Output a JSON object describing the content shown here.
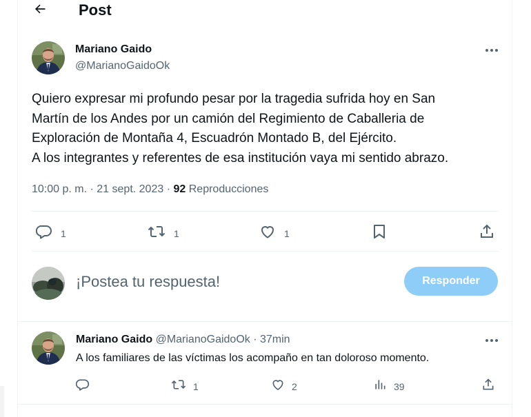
{
  "header": {
    "title": "Post",
    "back_icon": "arrow-left-icon"
  },
  "tweet": {
    "author_name": "Mariano Gaido",
    "author_handle": "@MarianoGaidoOk",
    "text_lines": [
      "Quiero expresar mi profundo pesar por la tragedia sufrida hoy en San",
      "Martín de los Andes por un camión del Regimiento de Caballeria de",
      "Exploración de Montaña 4, Escuadrón Montado B, del Ejército.",
      "A los integrantes y referentes de esa institución vaya mi sentido abrazo."
    ],
    "time": "10:00 p. m.",
    "date": "21 sept. 2023",
    "views_count": "92",
    "views_label": "Reproducciones",
    "separator": "·",
    "actions": {
      "reply_count": "1",
      "repost_count": "1",
      "like_count": "1"
    }
  },
  "composer": {
    "placeholder": "¡Postea tu respuesta!",
    "button_label": "Responder"
  },
  "reply": {
    "author_name": "Mariano Gaido",
    "author_handle": "@MarianoGaidoOk",
    "separator": "·",
    "time": "37min",
    "text": "A los familiares de las víctimas los acompaño en tan doloroso momento.",
    "actions": {
      "repost_count": "1",
      "like_count": "2",
      "views_count": "39"
    }
  },
  "colors": {
    "text_primary": "#0f1419",
    "text_secondary": "#536471",
    "divider": "#eff3f4",
    "reply_button_disabled": "#8ecdf8"
  }
}
